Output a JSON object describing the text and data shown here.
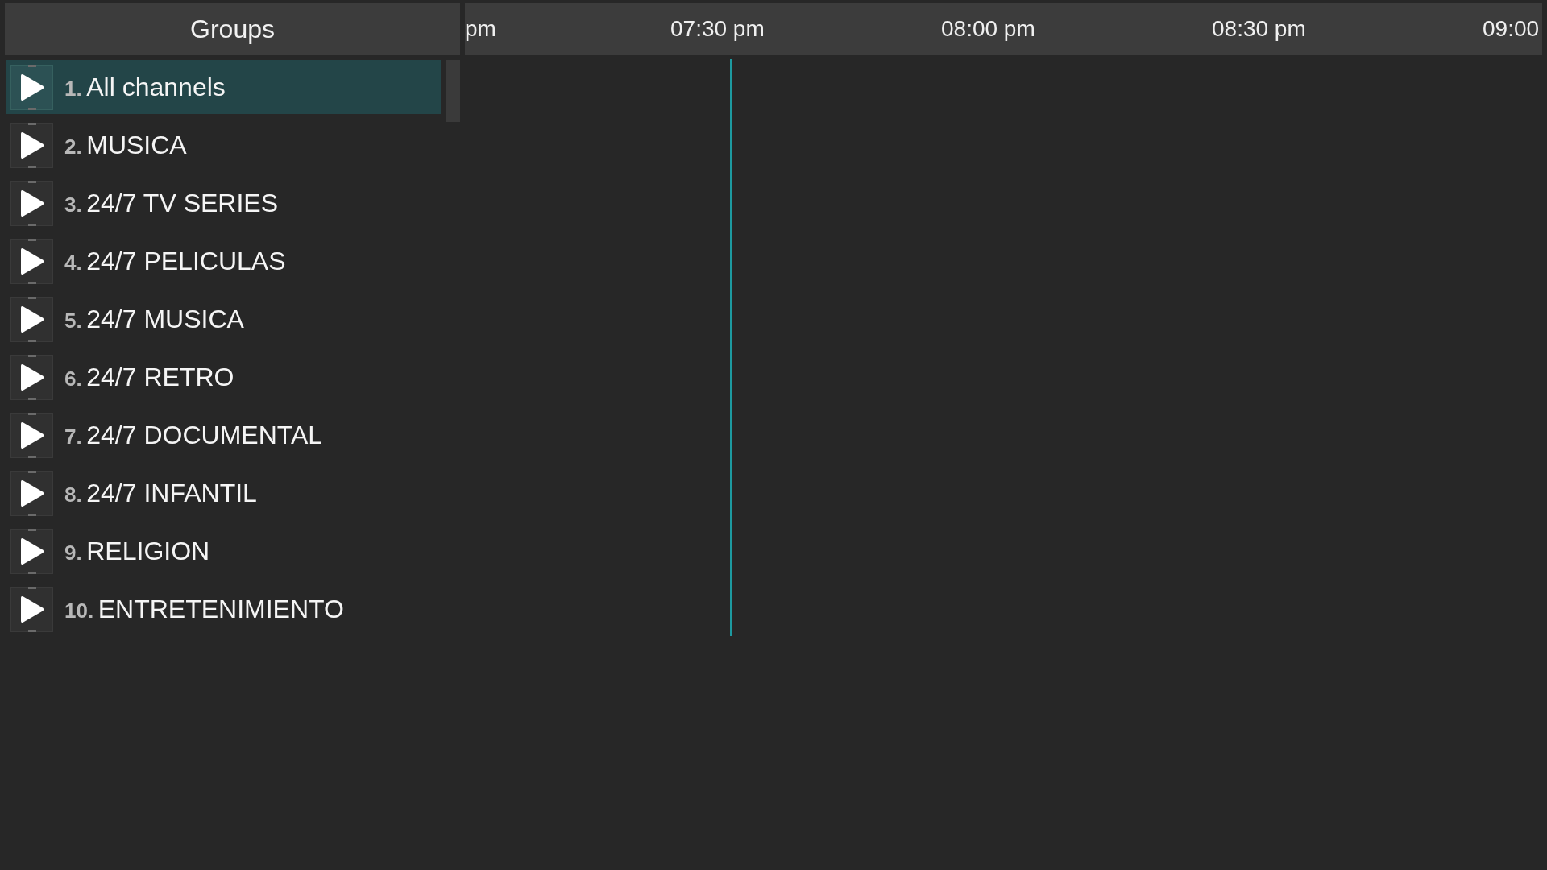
{
  "groups_header": {
    "title": "Groups"
  },
  "timeline": {
    "labels": [
      "pm",
      "07:30 pm",
      "08:00 pm",
      "08:30 pm",
      "09:00"
    ]
  },
  "groups": [
    {
      "number": "1.",
      "name": "All channels",
      "selected": true
    },
    {
      "number": "2.",
      "name": "MUSICA",
      "selected": false
    },
    {
      "number": "3.",
      "name": "24/7 TV SERIES",
      "selected": false
    },
    {
      "number": "4.",
      "name": "24/7 PELICULAS",
      "selected": false
    },
    {
      "number": "5.",
      "name": "24/7 MUSICA",
      "selected": false
    },
    {
      "number": "6.",
      "name": "24/7 RETRO",
      "selected": false
    },
    {
      "number": "7.",
      "name": "24/7 DOCUMENTAL",
      "selected": false
    },
    {
      "number": "8.",
      "name": "24/7 INFANTIL",
      "selected": false
    },
    {
      "number": "9.",
      "name": "RELIGION",
      "selected": false
    },
    {
      "number": "10.",
      "name": "ENTRETENIMIENTO",
      "selected": false
    }
  ]
}
